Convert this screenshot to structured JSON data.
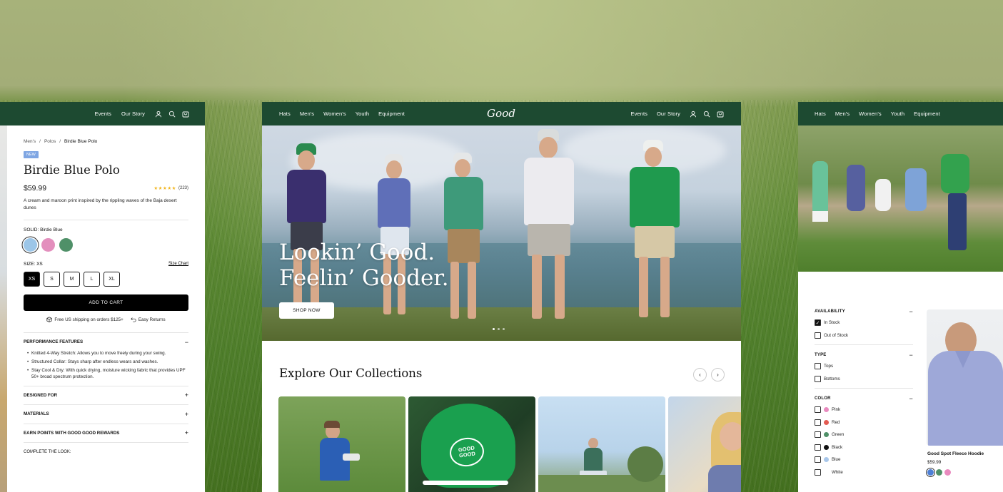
{
  "left_panel": {
    "nav": {
      "events": "Events",
      "our_story": "Our Story"
    },
    "breadcrumb": [
      "Men's",
      "Polos",
      "Birdie Blue Polo"
    ],
    "separator": "/",
    "badge": "NEW",
    "title": "Birdie Blue Polo",
    "price": "$59.99",
    "stars": "★★★★★",
    "review_count": "(223)",
    "description": "A cream and maroon print inspired by the rippling waves of the Baja desert dunes",
    "color_label": "SOLID:",
    "color_value": "Birdie Blue",
    "swatches": [
      "#9cc6e8",
      "#e38fbd",
      "#4f9068"
    ],
    "size_label": "SIZE:",
    "size_value": "XS",
    "size_chart": "Size Chart",
    "sizes": [
      "XS",
      "S",
      "M",
      "L",
      "XL"
    ],
    "add_to_cart": "ADD TO CART",
    "shipping": "Free US shipping on orders $125+",
    "returns": "Easy Returns",
    "accordions": {
      "performance": "PERFORMANCE FEATURES",
      "designed_for": "DESIGNED FOR",
      "materials": "MATERIALS",
      "rewards": "EARN POINTS WITH GOOD GOOD REWARDS",
      "complete": "COMPLETE THE LOOK:"
    },
    "features": [
      "Knitted 4-Way Stretch: Allows you to move freely during your swing.",
      "Structured Collar: Stays sharp after endless wears and washes.",
      "Stay Cool & Dry: With quick drying, moisture wicking fabric that provides UPF 50+ broad spectrum protection."
    ]
  },
  "center_panel": {
    "nav_left": [
      "Hats",
      "Men's",
      "Women's",
      "Youth",
      "Equipment"
    ],
    "logo": "Good",
    "nav_right": {
      "events": "Events",
      "our_story": "Our Story"
    },
    "headline_line1": "Lookin’ Good.",
    "headline_line2": "Feelin’ Gooder.",
    "shop_now": "SHOP NOW",
    "carousel_dots": 3,
    "section_title": "Explore Our Collections",
    "prev": "‹",
    "next": "›",
    "cap_text": "GOOD GOOD"
  },
  "right_panel": {
    "nav": [
      "Hats",
      "Men's",
      "Women's",
      "Youth",
      "Equipment"
    ],
    "filters": {
      "availability": {
        "title": "AVAILABILITY",
        "options": [
          {
            "label": "In Stock",
            "checked": true
          },
          {
            "label": "Out of Stock",
            "checked": false
          }
        ]
      },
      "type": {
        "title": "TYPE",
        "options": [
          {
            "label": "Tops",
            "checked": false
          },
          {
            "label": "Bottoms",
            "checked": false
          }
        ]
      },
      "color": {
        "title": "COLOR",
        "options": [
          {
            "label": "Pink",
            "color": "#e98bbf"
          },
          {
            "label": "Red",
            "color": "#e35b52"
          },
          {
            "label": "Green",
            "color": "#4f9068"
          },
          {
            "label": "Black",
            "color": "#111111"
          },
          {
            "label": "Blue",
            "color": "#a9c7ea"
          },
          {
            "label": "White",
            "color": "#ffffff"
          }
        ]
      },
      "collapse_sign": "−"
    },
    "product": {
      "name": "Good Spot Fleece Hoodie",
      "price": "$59.99",
      "swatches": [
        "#4d7fd6",
        "#4f9068",
        "#e98bbf"
      ]
    }
  },
  "colors": {
    "nav_green": "#1d4a31",
    "star": "#f2b51c",
    "badge": "#7fa6e3"
  }
}
